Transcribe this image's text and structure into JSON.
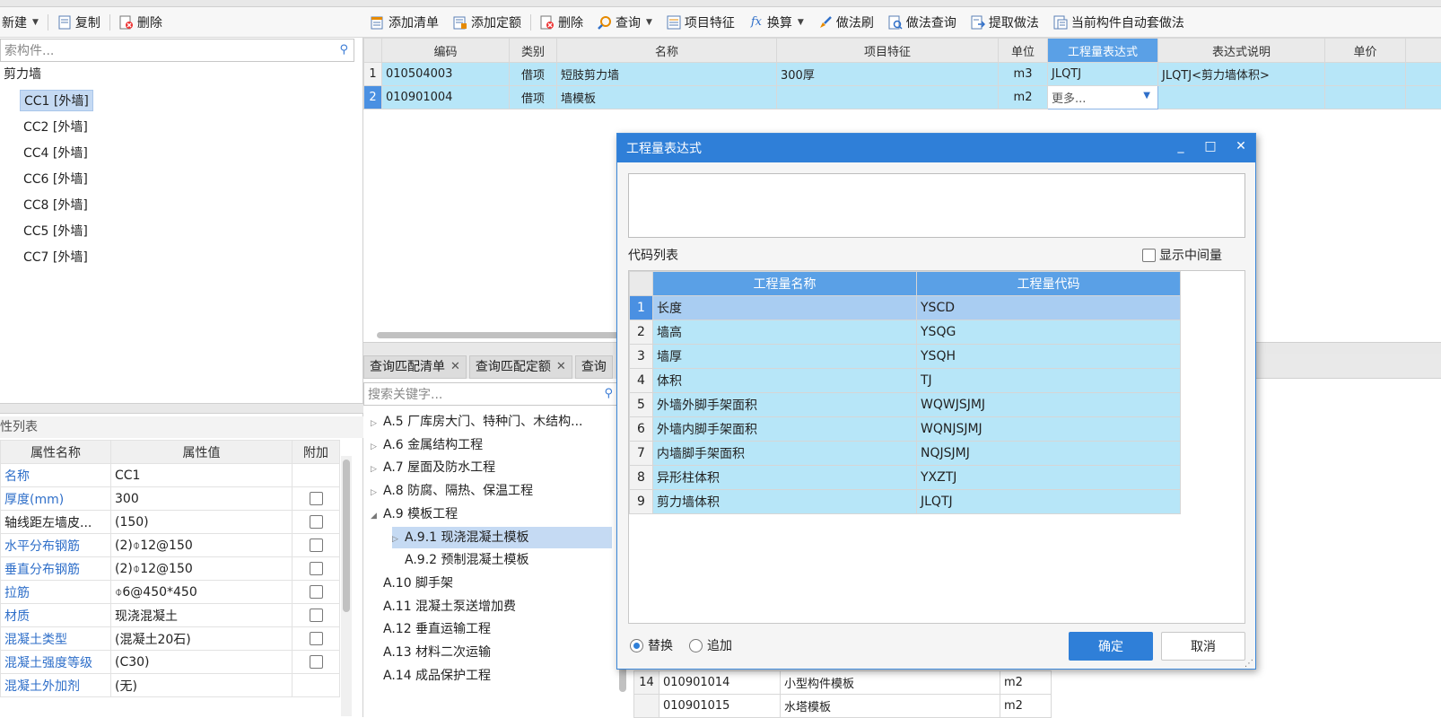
{
  "left_toolbar": {
    "new_label": "新建",
    "copy_label": "复制",
    "delete_label": "删除"
  },
  "component_search": {
    "placeholder": "索构件..."
  },
  "tree": {
    "root": "剪力墙",
    "items": [
      "CC1 [外墙]",
      "CC2 [外墙]",
      "CC4 [外墙]",
      "CC6 [外墙]",
      "CC8 [外墙]",
      "CC5 [外墙]",
      "CC7 [外墙]"
    ]
  },
  "attr_panel": {
    "title": "性列表",
    "headers": [
      "属性名称",
      "属性值",
      "附加"
    ],
    "rows": [
      {
        "name": "名称",
        "value": "CC1",
        "blue": true,
        "check": false
      },
      {
        "name": "厚度(mm)",
        "value": "300",
        "blue": true,
        "check": true
      },
      {
        "name": "轴线距左墙皮...",
        "value": "(150)",
        "blue": false,
        "check": true
      },
      {
        "name": "水平分布钢筋",
        "value": "(2)⌽12@150",
        "blue": true,
        "check": true
      },
      {
        "name": "垂直分布钢筋",
        "value": "(2)⌽12@150",
        "blue": true,
        "check": true
      },
      {
        "name": "拉筋",
        "value": "⌽6@450*450",
        "blue": true,
        "check": true
      },
      {
        "name": "材质",
        "value": "现浇混凝土",
        "blue": true,
        "check": true
      },
      {
        "name": "混凝土类型",
        "value": "(混凝土20石)",
        "blue": true,
        "check": true
      },
      {
        "name": "混凝土强度等级",
        "value": "(C30)",
        "blue": true,
        "check": true
      },
      {
        "name": "混凝土外加剂",
        "value": "(无)",
        "blue": true,
        "check": false
      }
    ]
  },
  "main_toolbar": {
    "add_list": "添加清单",
    "add_quota": "添加定额",
    "delete": "删除",
    "query": "查询",
    "item_feature": "项目特征",
    "convert": "换算",
    "method_brush": "做法刷",
    "method_query": "做法查询",
    "extract_method": "提取做法",
    "auto_method": "当前构件自动套做法"
  },
  "main_grid": {
    "headers": [
      "编码",
      "类别",
      "名称",
      "项目特征",
      "单位",
      "工程量表达式",
      "表达式说明",
      "单价"
    ],
    "rows": [
      {
        "num": "1",
        "code": "010504003",
        "type": "借项",
        "name": "短肢剪力墙",
        "feature": "300厚",
        "unit": "m3",
        "expr": "JLQTJ",
        "desc": "JLQTJ<剪力墙体积>",
        "price": ""
      },
      {
        "num": "2",
        "code": "010901004",
        "type": "借项",
        "name": "墙模板",
        "feature": "",
        "unit": "m2",
        "expr": "更多...",
        "desc": "",
        "price": ""
      }
    ]
  },
  "bottom_tabs": [
    {
      "label": "查询匹配清单"
    },
    {
      "label": "查询匹配定额"
    },
    {
      "label": "查询"
    }
  ],
  "lib_search": {
    "placeholder": "搜索关键字..."
  },
  "lib_tree": [
    {
      "label": "A.5 厂库房大门、特种门、木结构...",
      "expander": "▷"
    },
    {
      "label": "A.6 金属结构工程",
      "expander": "▷"
    },
    {
      "label": "A.7 屋面及防水工程",
      "expander": "▷"
    },
    {
      "label": "A.8 防腐、隔热、保温工程",
      "expander": "▷"
    },
    {
      "label": "A.9 模板工程",
      "expander": "◢"
    },
    {
      "label": "A.9.1 现浇混凝土模板",
      "expander": "▷"
    },
    {
      "label": "A.9.2 预制混凝土模板",
      "expander": ""
    },
    {
      "label": "A.10 脚手架",
      "expander": ""
    },
    {
      "label": "A.11 混凝土泵送增加费",
      "expander": ""
    },
    {
      "label": "A.12 垂直运输工程",
      "expander": ""
    },
    {
      "label": "A.13 材料二次运输",
      "expander": ""
    },
    {
      "label": "A.14 成品保护工程",
      "expander": ""
    }
  ],
  "lower_grid": {
    "rows": [
      {
        "num": "14",
        "code": "010901014",
        "name": "小型构件模板",
        "unit": "m2"
      },
      {
        "num": "",
        "code": "010901015",
        "name": "水塔模板",
        "unit": "m2"
      }
    ]
  },
  "dialog": {
    "title": "工程量表达式",
    "expression_value": "",
    "code_list_label": "代码列表",
    "show_intermediate": "显示中间量",
    "headers": [
      "工程量名称",
      "工程量代码"
    ],
    "rows": [
      {
        "num": "1",
        "name": "长度",
        "code": "YSCD"
      },
      {
        "num": "2",
        "name": "墙高",
        "code": "YSQG"
      },
      {
        "num": "3",
        "name": "墙厚",
        "code": "YSQH"
      },
      {
        "num": "4",
        "name": "体积",
        "code": "TJ"
      },
      {
        "num": "5",
        "name": "外墙外脚手架面积",
        "code": "WQWJSJMJ"
      },
      {
        "num": "6",
        "name": "外墙内脚手架面积",
        "code": "WQNJSJMJ"
      },
      {
        "num": "7",
        "name": "内墙脚手架面积",
        "code": "NQJSJMJ"
      },
      {
        "num": "8",
        "name": "异形柱体积",
        "code": "YXZTJ"
      },
      {
        "num": "9",
        "name": "剪力墙体积",
        "code": "JLQTJ"
      }
    ],
    "replace_label": "替换",
    "append_label": "追加",
    "ok_label": "确定",
    "cancel_label": "取消"
  },
  "colors": {
    "accent": "#2f7fd8",
    "row_highlight": "#b7e6f8",
    "header_highlight": "#5aa0e6"
  }
}
